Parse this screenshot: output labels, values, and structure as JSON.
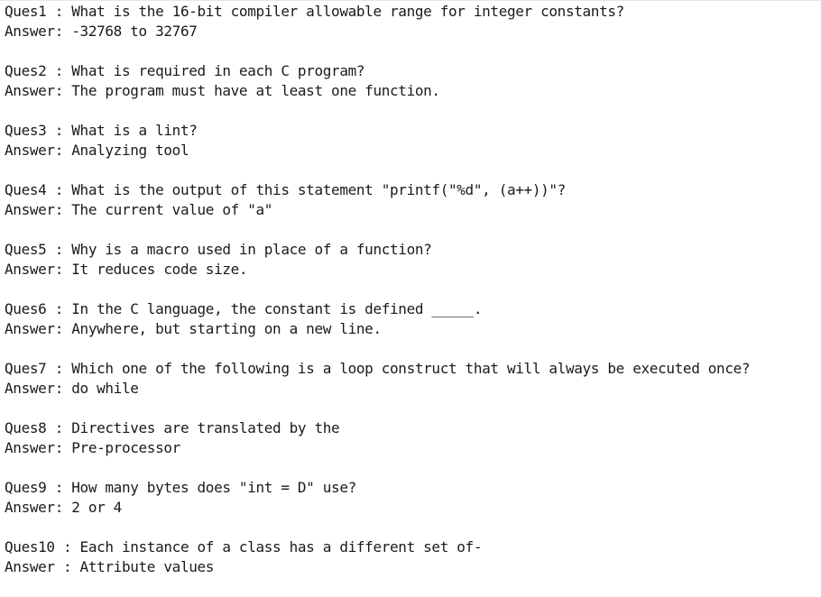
{
  "qa": [
    {
      "question_label": "Ques1 : ",
      "question": "What is the 16-bit compiler allowable range for integer constants?",
      "answer_label": "Answer: ",
      "answer": "-32768 to 32767"
    },
    {
      "question_label": "Ques2 : ",
      "question": "What is required in each C program?",
      "answer_label": "Answer: ",
      "answer": "The program must have at least one function."
    },
    {
      "question_label": "Ques3 : ",
      "question": "What is a lint?",
      "answer_label": "Answer: ",
      "answer": "Analyzing tool"
    },
    {
      "question_label": "Ques4 : ",
      "question": "What is the output of this statement \"printf(\"%d\", (a++))\"?",
      "answer_label": "Answer: ",
      "answer": "The current value of \"a\""
    },
    {
      "question_label": "Ques5 : ",
      "question": "Why is a macro used in place of a function?",
      "answer_label": "Answer: ",
      "answer": "It reduces code size."
    },
    {
      "question_label": "Ques6 : ",
      "question": "In the C language, the constant is defined _____.",
      "answer_label": "Answer: ",
      "answer": "Anywhere, but starting on a new line."
    },
    {
      "question_label": "Ques7 : ",
      "question": "Which one of the following is a loop construct that will always be executed once?",
      "answer_label": "Answer: ",
      "answer": "do while"
    },
    {
      "question_label": "Ques8 : ",
      "question": "Directives are translated by the",
      "answer_label": "Answer: ",
      "answer": "Pre-processor"
    },
    {
      "question_label": "Ques9 : ",
      "question": "How many bytes does \"int = D\" use?",
      "answer_label": "Answer: ",
      "answer": "2 or 4"
    },
    {
      "question_label": "Ques10 : ",
      "question": "Each instance of a class has a different set of-",
      "answer_label": "Answer : ",
      "answer": "Attribute values"
    }
  ]
}
